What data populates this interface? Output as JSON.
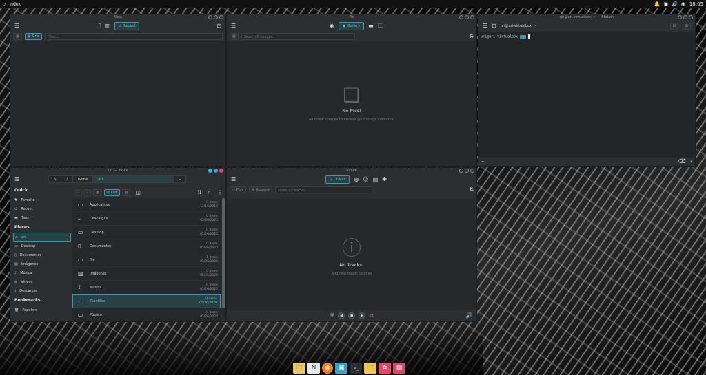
{
  "topbar": {
    "app_name": "Index",
    "clock": "18:05",
    "arrow_icon": "play-icon"
  },
  "nota": {
    "title": "Nota",
    "recent_label": "Recent",
    "grid_label": "Grid",
    "filter_placeholder": "Filter..."
  },
  "pix": {
    "title": "Pix",
    "gallery_label": "Gallery",
    "search_placeholder": "Search 0 images",
    "empty_title": "No Pics!",
    "empty_text": "Add new sources to browse your image collection"
  },
  "station": {
    "title": "uri@uri-virtualbox: ~ — Station",
    "tab_label": "uri@uri-virtualbox: ~",
    "prompt_user": "uri@uri-virtualbox",
    "prompt_path": "~"
  },
  "index": {
    "title": "uri — Index",
    "crumbs": [
      "/",
      "home",
      "uri"
    ],
    "list_label": "List",
    "sections": {
      "quick": "Quick",
      "places": "Places",
      "bookmarks": "Bookmarks"
    },
    "quick_items": [
      {
        "label": "Favorite",
        "icon": "heart-icon"
      },
      {
        "label": "Recent",
        "icon": "history-icon"
      },
      {
        "label": "Tags",
        "icon": "tag-icon"
      }
    ],
    "place_items": [
      {
        "label": "uri",
        "icon": "home-icon"
      },
      {
        "label": "Desktop",
        "icon": "desktop-icon"
      },
      {
        "label": "Documentos",
        "icon": "document-icon"
      },
      {
        "label": "Imágenes",
        "icon": "image-icon"
      },
      {
        "label": "Música",
        "icon": "music-icon"
      },
      {
        "label": "Vídeos",
        "icon": "video-icon"
      },
      {
        "label": "Descargas",
        "icon": "download-icon"
      }
    ],
    "bookmark_items": [
      {
        "label": "Papelera",
        "icon": "trash-icon"
      }
    ],
    "files": [
      {
        "name": "Applications",
        "count": "0 items",
        "date": "12/16/2019"
      },
      {
        "name": "Descargas",
        "count": "0 items",
        "date": "05/26/2020"
      },
      {
        "name": "Desktop",
        "count": "0 items",
        "date": "05/26/2020"
      },
      {
        "name": "Documentos",
        "count": "0 items",
        "date": "05/26/2020"
      },
      {
        "name": "file",
        "count": "1 items",
        "date": "05/26/2020"
      },
      {
        "name": "Imágenes",
        "count": "0 items",
        "date": "05/26/2020"
      },
      {
        "name": "Música",
        "count": "0 items",
        "date": "05/26/2020"
      },
      {
        "name": "Plantillas",
        "count": "0 items",
        "date": "05/26/2020"
      },
      {
        "name": "Público",
        "count": "0 items",
        "date": "05/26/2020"
      }
    ]
  },
  "vvave": {
    "title": "Vvave",
    "tracks_label": "Tracks",
    "play_label": "Play",
    "append_label": "Append",
    "search_placeholder": "Search 0 tracks",
    "empty_title": "No Tracks!",
    "empty_text": "Add new music sources"
  },
  "colors": {
    "accent": "#3f97a8",
    "accent_text": "#67c3d4",
    "window_bg": "#2b2f32"
  }
}
